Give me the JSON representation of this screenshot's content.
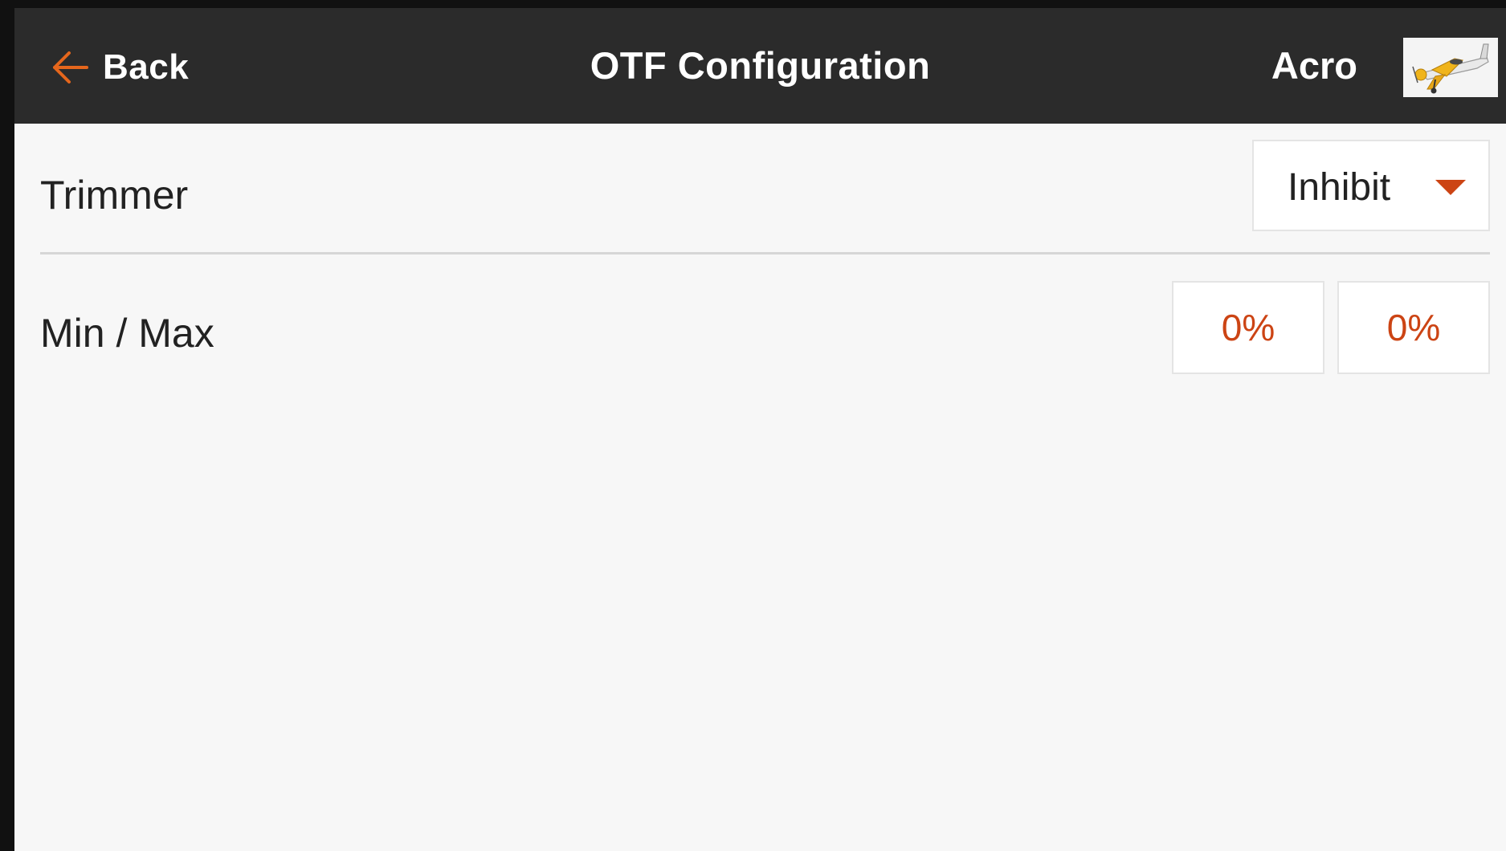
{
  "header": {
    "back_label": "Back",
    "back_icon": "arrow-left-icon",
    "title": "OTF Configuration",
    "model_name": "Acro",
    "model_thumbnail_icon": "airplane-icon"
  },
  "rows": {
    "trimmer": {
      "label": "Trimmer",
      "selected_value": "Inhibit",
      "dropdown_icon": "caret-down-icon"
    },
    "min_max": {
      "label": "Min / Max",
      "min_value": "0%",
      "max_value": "0%"
    }
  },
  "colors": {
    "accent": "#cc4414",
    "header_bg": "#2b2b2b",
    "page_bg": "#f7f7f7"
  }
}
